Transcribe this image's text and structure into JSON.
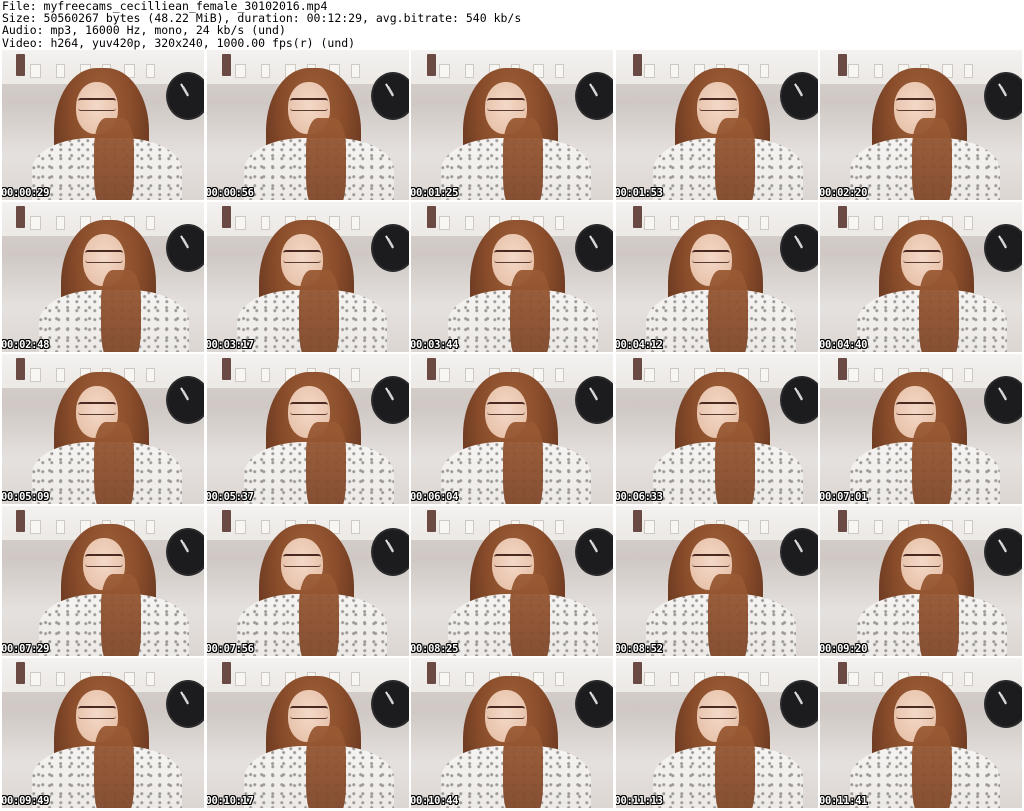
{
  "header": {
    "file": "File: myfreecams_cecilliean_female_30102016.mp4",
    "size": "Size: 50560267 bytes (48.22 MiB), duration: 00:12:29, avg.bitrate: 540 kb/s",
    "audio": "Audio: mp3, 16000 Hz, mono, 24 kb/s (und)",
    "video": "Video: h264, yuv420p, 320x240, 1000.00 fps(r) (und)"
  },
  "thumbnails": [
    {
      "timestamp": "00:00:29"
    },
    {
      "timestamp": "00:00:56"
    },
    {
      "timestamp": "00:01:25"
    },
    {
      "timestamp": "00:01:53"
    },
    {
      "timestamp": "00:02:20"
    },
    {
      "timestamp": "00:02:48"
    },
    {
      "timestamp": "00:03:17"
    },
    {
      "timestamp": "00:03:44"
    },
    {
      "timestamp": "00:04:12"
    },
    {
      "timestamp": "00:04:40"
    },
    {
      "timestamp": "00:05:09"
    },
    {
      "timestamp": "00:05:37"
    },
    {
      "timestamp": "00:06:04"
    },
    {
      "timestamp": "00:06:33"
    },
    {
      "timestamp": "00:07:01"
    },
    {
      "timestamp": "00:07:29"
    },
    {
      "timestamp": "00:07:56"
    },
    {
      "timestamp": "00:08:25"
    },
    {
      "timestamp": "00:08:52"
    },
    {
      "timestamp": "00:09:20"
    },
    {
      "timestamp": "00:09:49"
    },
    {
      "timestamp": "00:10:17"
    },
    {
      "timestamp": "00:10:44"
    },
    {
      "timestamp": "00:11:13"
    },
    {
      "timestamp": "00:11:41"
    }
  ]
}
